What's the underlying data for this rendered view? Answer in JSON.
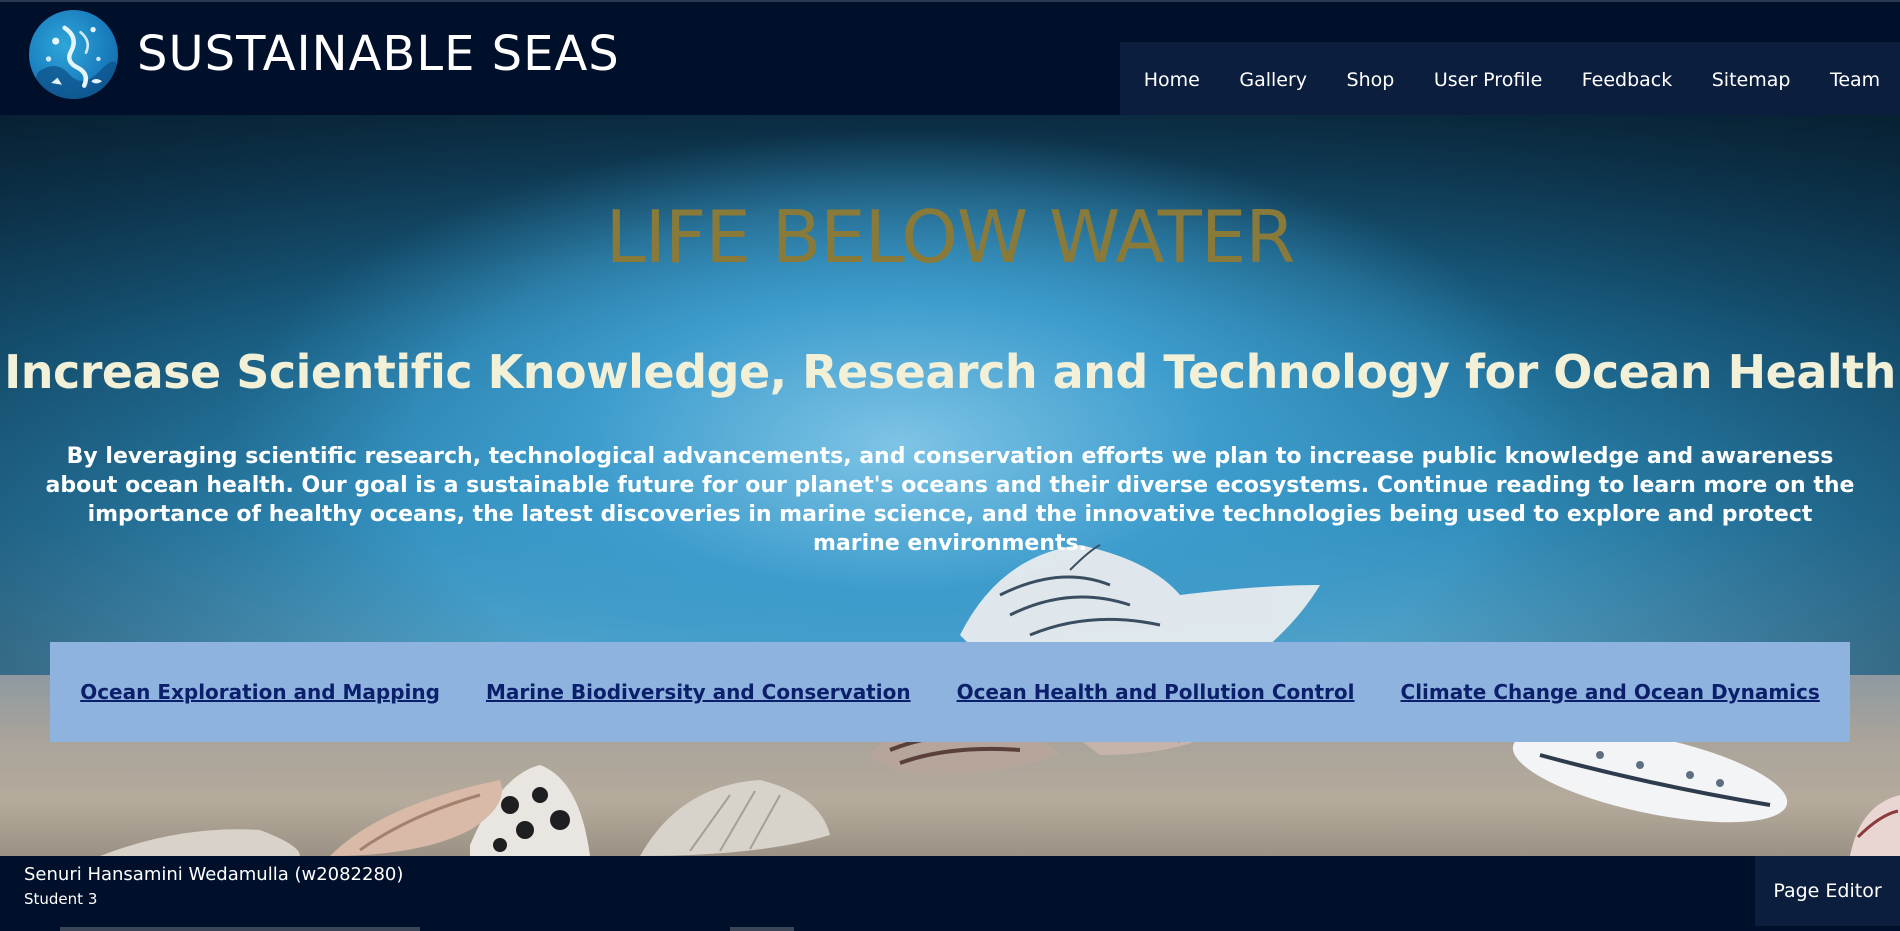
{
  "header": {
    "site_title": "SUSTAINABLE SEAS",
    "logo_icon": "ocean-logo-icon",
    "nav": [
      {
        "label": "Home"
      },
      {
        "label": "Gallery"
      },
      {
        "label": "Shop"
      },
      {
        "label": "User Profile"
      },
      {
        "label": "Feedback"
      },
      {
        "label": "Sitemap"
      },
      {
        "label": "Team"
      }
    ]
  },
  "hero": {
    "title": "LIFE BELOW WATER",
    "subtitle": "Increase Scientific Knowledge, Research and Technology for Ocean Health",
    "text": "By leveraging scientific research, technological advancements, and conservation efforts we plan to increase public knowledge and awareness about ocean health. Our goal is a sustainable future for our planet's oceans and their diverse ecosystems. Continue reading to learn more on the importance of healthy oceans, the latest discoveries in marine science, and the innovative technologies being used to explore and protect marine environments.",
    "topic_links": [
      {
        "label": "Ocean Exploration and Mapping"
      },
      {
        "label": "Marine Biodiversity and Conservation"
      },
      {
        "label": "Ocean Health and Pollution Control"
      },
      {
        "label": "Climate Change and Ocean Dynamics"
      }
    ]
  },
  "footer": {
    "author_name": "Senuri Hansamini Wedamulla (w2082280)",
    "author_role": "Student 3",
    "page_editor_label": "Page Editor"
  },
  "colors": {
    "header_bg": "#00102b",
    "nav_bg": "#0c1e3e",
    "title_gold": "#8a7a3a",
    "subtitle_cream": "#f3f0d8",
    "links_bar_bg": "#8fb3df",
    "link_color": "#0b1f6b"
  }
}
